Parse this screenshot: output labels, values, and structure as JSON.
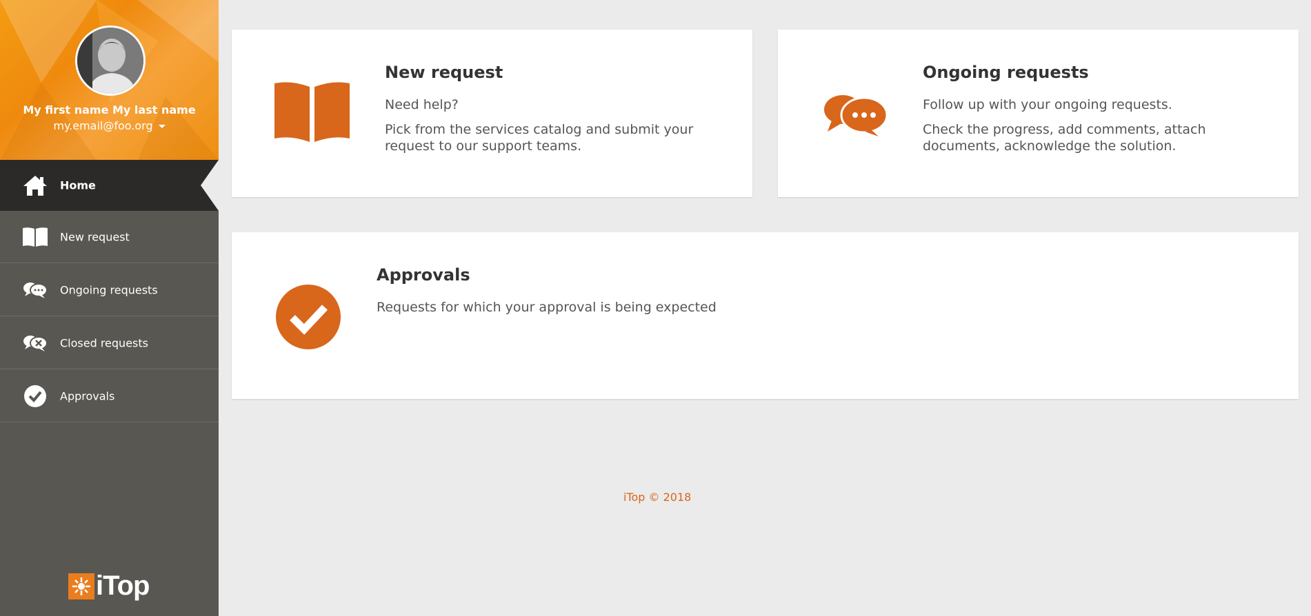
{
  "user": {
    "name": "My first name My last name",
    "email": "my.email@foo.org"
  },
  "nav": {
    "items": [
      {
        "label": "Home",
        "icon": "home-icon",
        "active": true
      },
      {
        "label": "New request",
        "icon": "book-icon"
      },
      {
        "label": "Ongoing requests",
        "icon": "chat-bubbles-icon"
      },
      {
        "label": "Closed requests",
        "icon": "chat-closed-icon"
      },
      {
        "label": "Approvals",
        "icon": "check-circle-icon"
      }
    ]
  },
  "cards": {
    "new_request": {
      "title": "New request",
      "line1": "Need help?",
      "line2": "Pick from the services catalog and submit your request to our support teams.",
      "icon": "book-icon"
    },
    "ongoing_requests": {
      "title": "Ongoing requests",
      "line1": "Follow up with your ongoing requests.",
      "line2": "Check the progress, add comments, attach documents, acknowledge the solution.",
      "icon": "chat-bubbles-icon"
    },
    "approvals": {
      "title": "Approvals",
      "line1": "Requests for which your approval is being expected",
      "icon": "check-circle-icon"
    }
  },
  "footer": {
    "text": "iTop © 2018"
  },
  "logo": {
    "text": "iTop"
  },
  "colors": {
    "accent": "#d8661b",
    "sidebar": "#585752",
    "active_nav": "#2b2a28",
    "header_orange": "#f39c12",
    "background": "#ebebeb"
  }
}
